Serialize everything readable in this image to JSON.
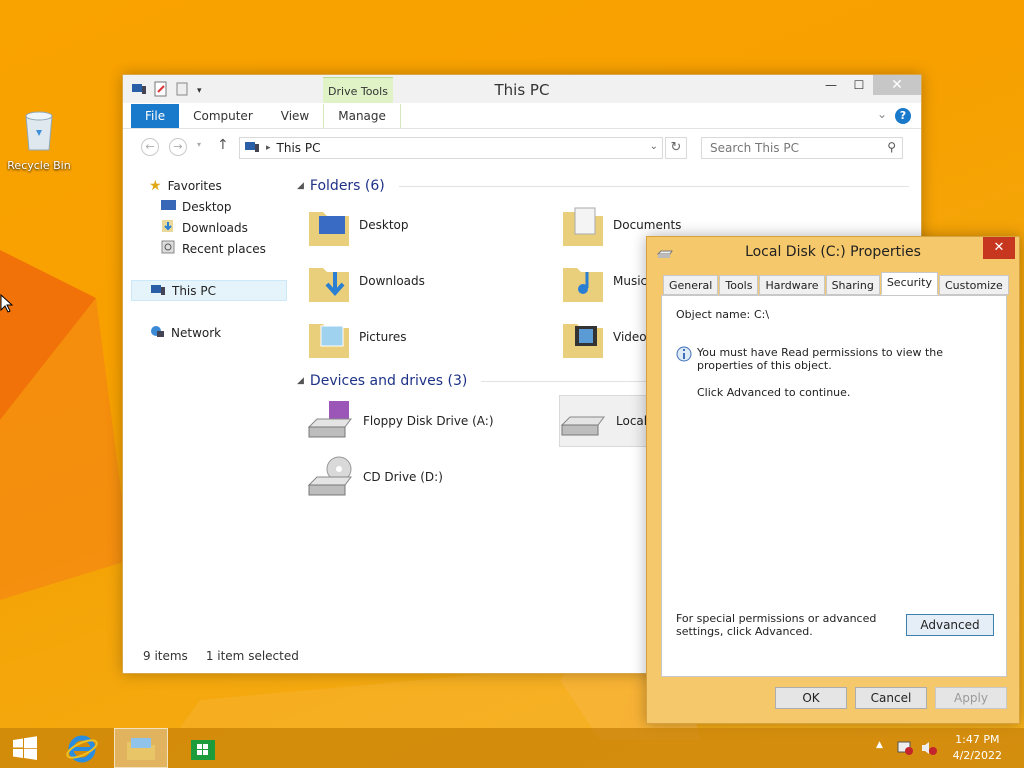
{
  "desktop": {
    "recycle_bin_label": "Recycle Bin"
  },
  "explorer": {
    "title": "This PC",
    "contextual_tab_header": "Drive Tools",
    "tabs": [
      "File",
      "Computer",
      "View",
      "Manage"
    ],
    "address": "This PC",
    "search_placeholder": "Search This PC",
    "nav": {
      "favorites": "Favorites",
      "desktop": "Desktop",
      "downloads": "Downloads",
      "recent": "Recent places",
      "this_pc": "This PC",
      "network": "Network"
    },
    "folders_header": "Folders (6)",
    "folders": [
      "Desktop",
      "Documents",
      "Downloads",
      "Music",
      "Pictures",
      "Videos"
    ],
    "devices_header": "Devices and drives (3)",
    "devices": [
      "Floppy Disk Drive (A:)",
      "Local",
      "CD Drive (D:)"
    ],
    "status_items": "9 items",
    "status_selected": "1 item selected"
  },
  "properties": {
    "title": "Local Disk (C:) Properties",
    "tabs": [
      "General",
      "Tools",
      "Hardware",
      "Sharing",
      "Security",
      "Customize"
    ],
    "active_tab": "Security",
    "object_name_label": "Object name:",
    "object_name_value": "C:\\",
    "message": "You must have Read permissions to view the properties of this object.",
    "continue_text": "Click Advanced to continue.",
    "special_text": "For special permissions or advanced settings, click Advanced.",
    "advanced_button": "Advanced",
    "ok_button": "OK",
    "cancel_button": "Cancel",
    "apply_button": "Apply"
  },
  "taskbar": {
    "time": "1:47 PM",
    "date": "4/2/2022"
  },
  "colors": {
    "accent": "#1979ca",
    "desktop": "#f7a000",
    "dialog_frame": "#f5c86b",
    "close_red": "#c7371f"
  }
}
